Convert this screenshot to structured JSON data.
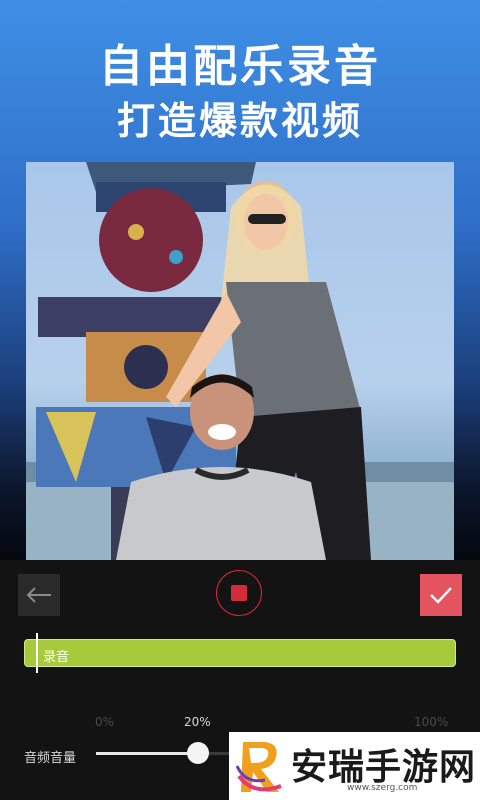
{
  "headline": {
    "line1": "自由配乐录音",
    "line2": "打造爆款视频"
  },
  "toolbar": {
    "back_icon": "arrow-left-icon",
    "record_icon": "stop-icon",
    "confirm_icon": "checkmark-icon"
  },
  "track": {
    "label": "录音"
  },
  "volume": {
    "label": "音频音量",
    "ticks": [
      "0%",
      "20%",
      "100%"
    ],
    "value_percent": 20
  },
  "watermark": {
    "name": "安瑞手游网",
    "url": "www.szerg.com"
  },
  "colors": {
    "confirm": "#e4545f",
    "record": "#d42b3a",
    "track": "#a7ca3c"
  }
}
